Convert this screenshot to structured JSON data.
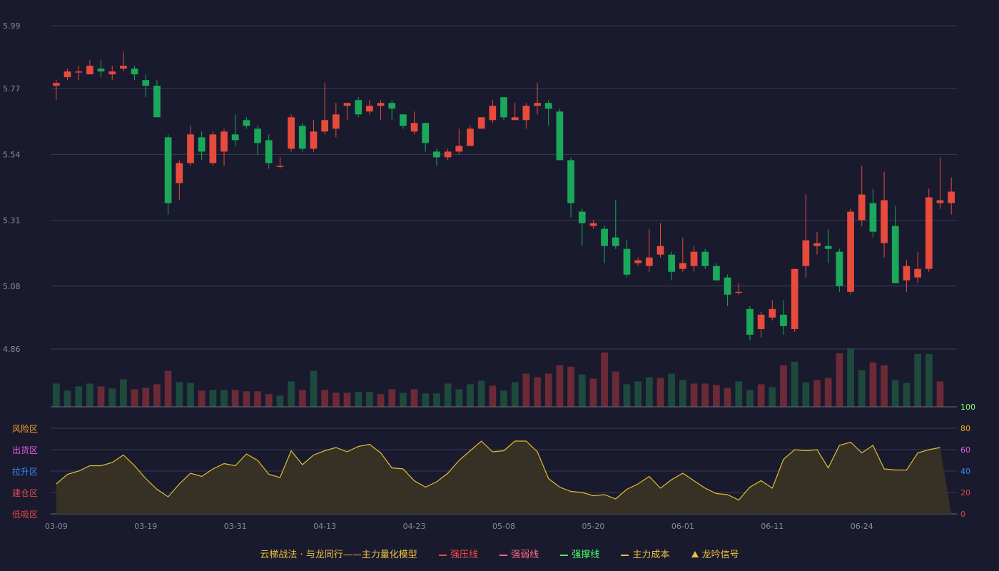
{
  "chart_data": {
    "type": "candlestick",
    "dates": [
      "03-09",
      "03-10",
      "03-11",
      "03-12",
      "03-13",
      "03-14",
      "03-15",
      "03-16",
      "03-17",
      "03-18",
      "03-19",
      "03-20",
      "03-21",
      "03-22",
      "03-23",
      "03-24",
      "03-25",
      "03-26",
      "03-27",
      "03-28",
      "03-29",
      "03-30",
      "03-31",
      "04-01",
      "04-02",
      "04-03",
      "04-04",
      "04-05",
      "04-06",
      "04-07",
      "04-08",
      "04-09",
      "04-10",
      "04-11",
      "04-12",
      "04-13",
      "04-14",
      "04-15",
      "04-16",
      "04-17",
      "04-18",
      "04-19",
      "04-20",
      "04-21",
      "04-22",
      "04-23",
      "04-24",
      "04-25",
      "04-26",
      "04-27",
      "04-28",
      "04-29",
      "04-30",
      "05-01",
      "05-02",
      "05-03",
      "05-04",
      "05-05",
      "05-06",
      "05-07",
      "05-08",
      "05-09",
      "05-10",
      "05-11",
      "05-12",
      "05-13",
      "05-14",
      "05-15",
      "05-16",
      "05-17",
      "05-18",
      "05-19",
      "05-20",
      "05-21",
      "05-22",
      "05-23",
      "05-24",
      "05-25",
      "05-26",
      "05-27",
      "05-28",
      "05-29",
      "05-30",
      "05-31",
      "06-01",
      "06-02",
      "06-03",
      "06-04",
      "06-05",
      "06-06",
      "06-07",
      "06-08",
      "06-09",
      "06-10",
      "06-11",
      "06-12",
      "06-13",
      "06-14",
      "06-15",
      "06-16",
      "06-17",
      "06-18",
      "06-19",
      "06-20",
      "06-21",
      "06-22",
      "06-23",
      "06-24",
      "06-25",
      "06-26",
      "06-27",
      "06-28",
      "06-29",
      "06-30",
      "07-01",
      "07-02",
      "07-03",
      "07-04",
      "07-05",
      "07-06",
      "07-07",
      "07-08",
      "07-09",
      "07-10",
      "07-11",
      "07-12",
      "07-13",
      "07-14",
      "07-15"
    ],
    "x_tick_labels": [
      "03-09",
      "03-19",
      "03-31",
      "04-13",
      "04-23",
      "05-08",
      "05-20",
      "06-01",
      "06-11",
      "06-24"
    ],
    "x_tick_indices": [
      0,
      8,
      16,
      24,
      32,
      40,
      48,
      56,
      64,
      72
    ],
    "candles": [
      [
        5.78,
        5.79,
        5.73,
        5.8
      ],
      [
        5.81,
        5.83,
        5.8,
        5.84
      ],
      [
        5.83,
        5.83,
        5.8,
        5.85
      ],
      [
        5.82,
        5.85,
        5.82,
        5.87
      ],
      [
        5.84,
        5.83,
        5.81,
        5.87
      ],
      [
        5.82,
        5.83,
        5.8,
        5.85
      ],
      [
        5.84,
        5.85,
        5.83,
        5.9
      ],
      [
        5.84,
        5.82,
        5.8,
        5.85
      ],
      [
        5.8,
        5.78,
        5.74,
        5.82
      ],
      [
        5.78,
        5.67,
        5.67,
        5.8
      ],
      [
        5.6,
        5.37,
        5.33,
        5.61
      ],
      [
        5.44,
        5.51,
        5.38,
        5.52
      ],
      [
        5.51,
        5.61,
        5.5,
        5.64
      ],
      [
        5.6,
        5.55,
        5.52,
        5.62
      ],
      [
        5.51,
        5.61,
        5.5,
        5.62
      ],
      [
        5.55,
        5.62,
        5.5,
        5.63
      ],
      [
        5.61,
        5.59,
        5.57,
        5.68
      ],
      [
        5.66,
        5.64,
        5.63,
        5.67
      ],
      [
        5.63,
        5.58,
        5.54,
        5.64
      ],
      [
        5.59,
        5.51,
        5.49,
        5.61
      ],
      [
        5.5,
        5.5,
        5.49,
        5.53
      ],
      [
        5.56,
        5.67,
        5.55,
        5.68
      ],
      [
        5.64,
        5.56,
        5.55,
        5.65
      ],
      [
        5.56,
        5.62,
        5.55,
        5.66
      ],
      [
        5.62,
        5.66,
        5.61,
        5.79
      ],
      [
        5.63,
        5.68,
        5.6,
        5.72
      ],
      [
        5.71,
        5.72,
        5.66,
        5.72
      ],
      [
        5.73,
        5.68,
        5.67,
        5.74
      ],
      [
        5.69,
        5.71,
        5.68,
        5.73
      ],
      [
        5.71,
        5.72,
        5.66,
        5.73
      ],
      [
        5.72,
        5.7,
        5.66,
        5.73
      ],
      [
        5.68,
        5.64,
        5.63,
        5.68
      ],
      [
        5.62,
        5.65,
        5.61,
        5.69
      ],
      [
        5.65,
        5.58,
        5.55,
        5.65
      ],
      [
        5.55,
        5.53,
        5.5,
        5.56
      ],
      [
        5.53,
        5.55,
        5.52,
        5.56
      ],
      [
        5.55,
        5.57,
        5.54,
        5.63
      ],
      [
        5.57,
        5.63,
        5.57,
        5.64
      ],
      [
        5.63,
        5.67,
        5.63,
        5.67
      ],
      [
        5.66,
        5.71,
        5.65,
        5.73
      ],
      [
        5.74,
        5.67,
        5.66,
        5.74
      ],
      [
        5.66,
        5.67,
        5.66,
        5.72
      ],
      [
        5.66,
        5.71,
        5.63,
        5.72
      ],
      [
        5.71,
        5.72,
        5.68,
        5.79
      ],
      [
        5.72,
        5.7,
        5.64,
        5.73
      ],
      [
        5.69,
        5.52,
        5.52,
        5.7
      ],
      [
        5.52,
        5.37,
        5.32,
        5.53
      ],
      [
        5.34,
        5.3,
        5.22,
        5.35
      ],
      [
        5.29,
        5.3,
        5.28,
        5.31
      ],
      [
        5.28,
        5.22,
        5.16,
        5.29
      ],
      [
        5.25,
        5.22,
        5.21,
        5.38
      ],
      [
        5.21,
        5.12,
        5.11,
        5.24
      ],
      [
        5.16,
        5.17,
        5.15,
        5.18
      ],
      [
        5.15,
        5.18,
        5.13,
        5.28
      ],
      [
        5.19,
        5.22,
        5.18,
        5.3
      ],
      [
        5.19,
        5.13,
        5.1,
        5.2
      ],
      [
        5.14,
        5.16,
        5.13,
        5.25
      ],
      [
        5.15,
        5.2,
        5.13,
        5.22
      ],
      [
        5.2,
        5.15,
        5.14,
        5.21
      ],
      [
        5.15,
        5.1,
        5.1,
        5.16
      ],
      [
        5.11,
        5.05,
        5.01,
        5.12
      ],
      [
        5.06,
        5.06,
        5.05,
        5.09
      ],
      [
        5.0,
        4.91,
        4.89,
        5.01
      ],
      [
        4.93,
        4.98,
        4.9,
        4.99
      ],
      [
        4.97,
        5.0,
        4.96,
        5.03
      ],
      [
        4.98,
        4.94,
        4.91,
        5.03
      ],
      [
        4.93,
        5.14,
        4.92,
        5.14
      ],
      [
        5.15,
        5.24,
        5.11,
        5.4
      ],
      [
        5.22,
        5.23,
        5.19,
        5.27
      ],
      [
        5.22,
        5.21,
        5.16,
        5.28
      ],
      [
        5.2,
        5.08,
        5.06,
        5.21
      ],
      [
        5.06,
        5.34,
        5.05,
        5.35
      ],
      [
        5.31,
        5.4,
        5.29,
        5.5
      ],
      [
        5.37,
        5.27,
        5.25,
        5.42
      ],
      [
        5.23,
        5.38,
        5.18,
        5.48
      ],
      [
        5.29,
        5.09,
        5.09,
        5.36
      ],
      [
        5.1,
        5.15,
        5.06,
        5.17
      ],
      [
        5.11,
        5.14,
        5.09,
        5.2
      ],
      [
        5.14,
        5.39,
        5.13,
        5.42
      ],
      [
        5.37,
        5.38,
        5.35,
        5.53
      ],
      [
        5.37,
        5.41,
        5.33,
        5.46
      ]
    ],
    "volume": [
      33,
      23,
      29,
      33,
      29,
      26,
      39,
      25,
      27,
      32,
      51,
      35,
      34,
      23,
      24,
      24,
      24,
      22,
      22,
      18,
      16,
      36,
      24,
      51,
      24,
      20,
      20,
      21,
      21,
      18,
      25,
      20,
      25,
      19,
      19,
      33,
      25,
      32,
      37,
      30,
      23,
      35,
      47,
      42,
      47,
      59,
      57,
      46,
      40,
      77,
      50,
      32,
      36,
      42,
      41,
      47,
      38,
      33,
      33,
      31,
      27,
      36,
      24,
      32,
      28,
      59,
      64,
      35,
      38,
      41,
      76,
      83,
      52,
      63,
      59,
      38,
      34,
      75,
      75,
      36
    ],
    "volume_colors": [
      "g",
      "g",
      "g",
      "g",
      "r",
      "g",
      "g",
      "r",
      "r",
      "r",
      "r",
      "g",
      "g",
      "r",
      "g",
      "g",
      "r",
      "r",
      "r",
      "r",
      "g",
      "g",
      "r",
      "g",
      "r",
      "r",
      "r",
      "g",
      "g",
      "r",
      "r",
      "g",
      "r",
      "g",
      "g",
      "g",
      "g",
      "g",
      "g",
      "r",
      "g",
      "g",
      "r",
      "r",
      "r",
      "r",
      "r",
      "g",
      "r",
      "r",
      "r",
      "g",
      "g",
      "g",
      "r",
      "g",
      "g",
      "r",
      "r",
      "r",
      "r",
      "g",
      "g",
      "r",
      "g",
      "r",
      "g",
      "g",
      "r",
      "r",
      "r",
      "g",
      "g",
      "r",
      "r",
      "g",
      "g",
      "g",
      "g",
      "r"
    ],
    "price_axis": {
      "ticks": [
        4.86,
        5.08,
        5.31,
        5.54,
        5.77,
        5.99
      ],
      "labels": [
        "4.86",
        "5.08",
        "5.31",
        "5.54",
        "5.77",
        "5.99"
      ],
      "ylim": [
        4.86,
        5.99
      ]
    },
    "indicator": {
      "name": "主力成本",
      "values": [
        28,
        37,
        40,
        45,
        45,
        48,
        55,
        45,
        33,
        23,
        16,
        28,
        38,
        35,
        42,
        47,
        45,
        56,
        50,
        37,
        34,
        59,
        46,
        55,
        59,
        62,
        58,
        63,
        65,
        57,
        43,
        42,
        31,
        25,
        30,
        38,
        50,
        59,
        68,
        58,
        59,
        68,
        68,
        58,
        33,
        25,
        21,
        20,
        17,
        18,
        14,
        23,
        28,
        35,
        24,
        32,
        38,
        31,
        24,
        19,
        18,
        13,
        25,
        31,
        24,
        51,
        60,
        59,
        60,
        43,
        64,
        67,
        57,
        64,
        42,
        41,
        41,
        57,
        60,
        62
      ],
      "ylim": [
        0,
        100
      ],
      "right_ticks": [
        "100",
        "80",
        "60",
        "40",
        "20",
        "0"
      ],
      "zones": [
        {
          "label": "风险区",
          "color": "#f5a623"
        },
        {
          "label": "出货区",
          "color": "#e25be0"
        },
        {
          "label": "拉升区",
          "color": "#3d8bff"
        },
        {
          "label": "建仓区",
          "color": "#e04848"
        },
        {
          "label": "低吸区",
          "color": "#e04848"
        }
      ]
    }
  },
  "legend": {
    "title": "云梯战法 · 与龙同行——主力量化模型",
    "items": [
      {
        "label": "强压线",
        "color": "#ff4a4a",
        "style": "solid"
      },
      {
        "label": "强弱线",
        "color": "#ff6a8a",
        "style": "dashed"
      },
      {
        "label": "强撑线",
        "color": "#4cff6a",
        "style": "solid"
      },
      {
        "label": "主力成本",
        "color": "#f0c040",
        "style": "dashed"
      },
      {
        "label": "龙吟信号",
        "color": "#f0c040",
        "style": "triangle"
      }
    ]
  },
  "colors": {
    "up": "#e84a3c",
    "down": "#1aa85a",
    "vol_up": "#6b2a36",
    "vol_down": "#1d4a3c",
    "line": "#e0c030",
    "grid": "#3a3b52",
    "axis_text": "#8a8a99"
  }
}
